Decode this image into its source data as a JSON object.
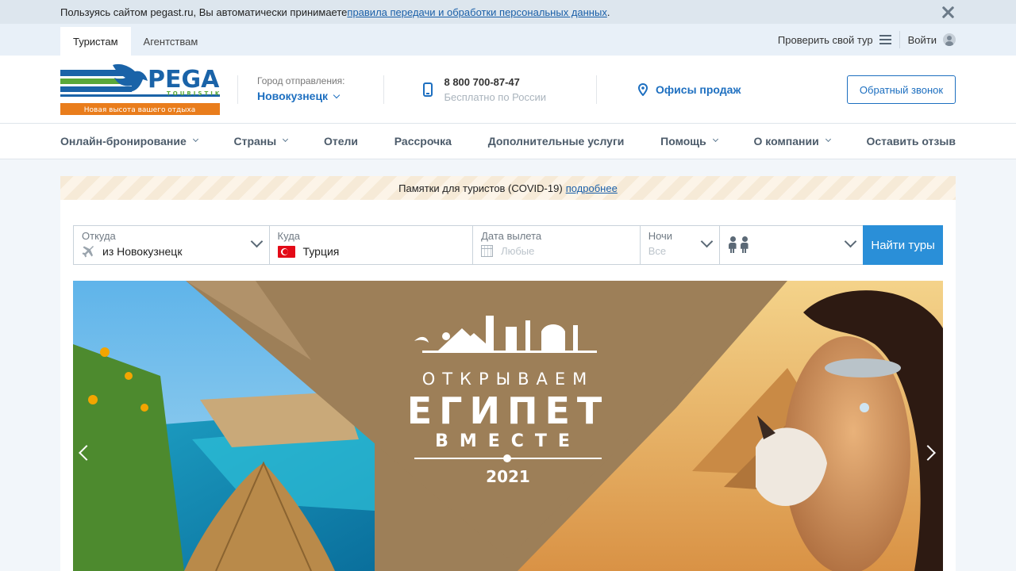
{
  "cookie": {
    "text": "Пользуясь сайтом pegast.ru, Вы автоматически принимаете ",
    "link": "правила передачи и обработки персональных данных",
    "tail": "."
  },
  "topbar": {
    "tabs": [
      {
        "label": "Туристам",
        "active": true
      },
      {
        "label": "Агентствам",
        "active": false
      }
    ],
    "check_tour": "Проверить свой тур",
    "login": "Войти"
  },
  "header": {
    "logo_brand": "PEGAS",
    "logo_sub": "TOURISTIK",
    "logo_slogan": "Новая высота вашего отдыха",
    "city_label": "Город отправления:",
    "city_value": "Новокузнецк",
    "phone_number": "8 800 700-87-47",
    "phone_note": "Бесплатно по России",
    "offices": "Офисы продаж",
    "callback": "Обратный звонок"
  },
  "nav": {
    "items": [
      {
        "label": "Онлайн-бронирование",
        "dropdown": true
      },
      {
        "label": "Страны",
        "dropdown": true
      },
      {
        "label": "Отели",
        "dropdown": false
      },
      {
        "label": "Рассрочка",
        "dropdown": false
      },
      {
        "label": "Дополнительные услуги",
        "dropdown": false
      },
      {
        "label": "Помощь",
        "dropdown": true
      },
      {
        "label": "О компании",
        "dropdown": true
      },
      {
        "label": "Оставить отзыв",
        "dropdown": false
      }
    ]
  },
  "notice": {
    "text": "Памятки для туристов (COVID-19)",
    "link": "подробнее"
  },
  "search": {
    "from_label": "Откуда",
    "from_value": "из Новокузнецк",
    "to_label": "Куда",
    "to_value": "Турция",
    "date_label": "Дата вылета",
    "date_placeholder": "Любые",
    "nights_label": "Ночи",
    "nights_value": "Все",
    "submit": "Найти туры"
  },
  "banner": {
    "line1": "ОТКРЫВАЕМ",
    "line2": "ЕГИПЕТ",
    "line3": "ВМЕСТЕ",
    "year": "2021"
  },
  "colors": {
    "brand_blue": "#1d6fc0",
    "button_blue": "#2a8fd8",
    "logo_orange": "#e97d1c",
    "logo_green": "#5aa83a"
  }
}
